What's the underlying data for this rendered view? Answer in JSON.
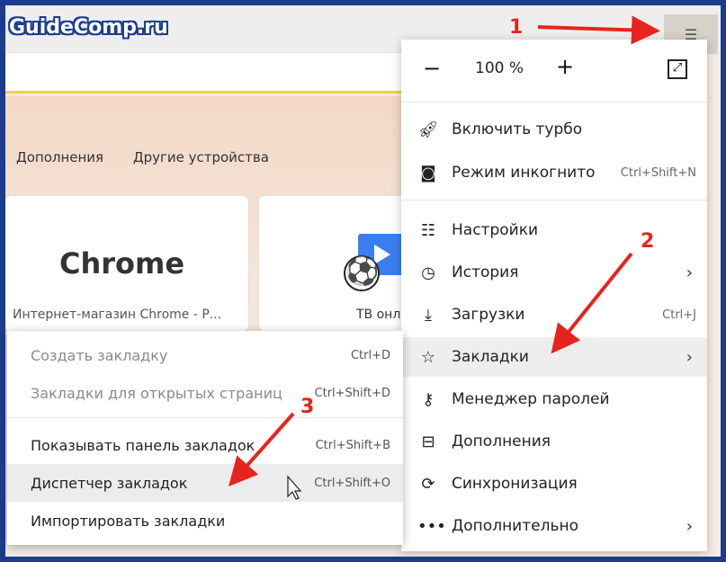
{
  "watermark": "GuideComp.ru",
  "browser": {
    "menu_button_icon": "hamburger-icon",
    "newtab_links": [
      "Дополнения",
      "Другие устройства"
    ],
    "tiles": [
      {
        "logo": "Chrome",
        "caption": "Интернет-магазин Chrome - Р..."
      },
      {
        "caption": "ТВ онла"
      }
    ]
  },
  "main_menu": {
    "zoom": {
      "minus": "−",
      "value": "100 %",
      "plus": "+",
      "fullscreen_icon": "fullscreen-icon"
    },
    "items": [
      {
        "label": "Включить турбо",
        "icon": "rocket-icon",
        "shortcut": ""
      },
      {
        "label": "Режим инкогнито",
        "icon": "mask-icon",
        "shortcut": "Ctrl+Shift+N"
      },
      {
        "label": "Настройки",
        "icon": "sliders-icon",
        "shortcut": ""
      },
      {
        "label": "История",
        "icon": "clock-icon",
        "shortcut": ""
      },
      {
        "label": "Загрузки",
        "icon": "download-icon",
        "shortcut": "Ctrl+J"
      },
      {
        "label": "Закладки",
        "icon": "star-icon",
        "shortcut": ""
      },
      {
        "label": "Менеджер паролей",
        "icon": "key-icon",
        "shortcut": ""
      },
      {
        "label": "Дополнения",
        "icon": "extensions-icon",
        "shortcut": ""
      },
      {
        "label": "Синхронизация",
        "icon": "sync-icon",
        "shortcut": ""
      },
      {
        "label": "Дополнительно",
        "icon": "more-icon",
        "shortcut": ""
      }
    ]
  },
  "bookmarks_submenu": {
    "items": [
      {
        "label": "Создать закладку",
        "shortcut": "Ctrl+D"
      },
      {
        "label": "Закладки для открытых страниц",
        "shortcut": "Ctrl+Shift+D"
      },
      {
        "label": "Показывать панель закладок",
        "shortcut": "Ctrl+Shift+B"
      },
      {
        "label": "Диспетчер закладок",
        "shortcut": "Ctrl+Shift+O"
      },
      {
        "label": "Импортировать закладки",
        "shortcut": ""
      }
    ]
  },
  "annotations": {
    "step1": "1",
    "step2": "2",
    "step3": "3",
    "arrow_color": "#e8231d"
  }
}
